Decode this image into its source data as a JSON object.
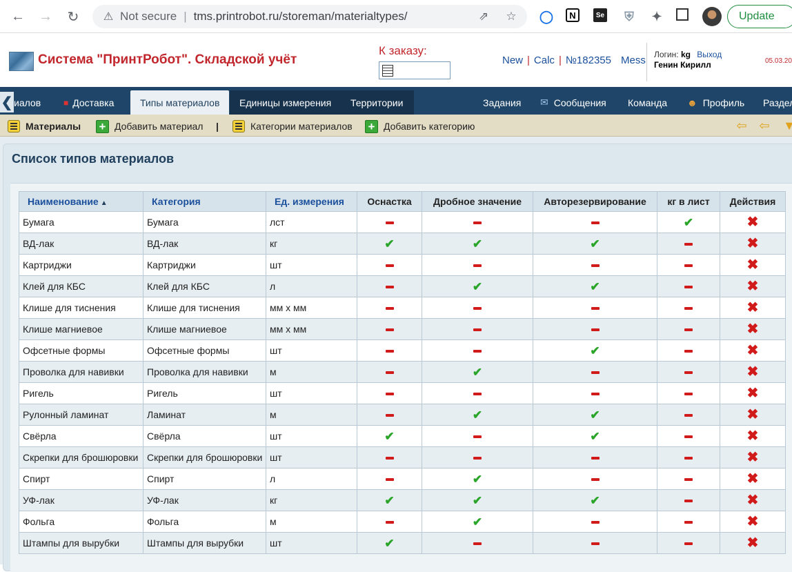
{
  "browser": {
    "security": "Not secure",
    "url": "tms.printrobot.ru/storeman/materialtypes/",
    "update_label": "Update"
  },
  "header": {
    "app_title": "Система \"ПринтРобот\". Складской учёт",
    "order_label": "К заказу:",
    "links": [
      "New",
      "Calc",
      "№182355",
      "Mess"
    ],
    "login_label": "Логин:",
    "login_value": "kg",
    "logout": "Выход",
    "user_name": "Генин Кирилл",
    "date": "05.03.20"
  },
  "tabs": {
    "left": [
      {
        "label": "иалов"
      },
      {
        "label": "Доставка"
      },
      {
        "label": "Типы материалов",
        "active": true
      },
      {
        "label": "Единицы измерения"
      },
      {
        "label": "Территории"
      }
    ],
    "right": [
      {
        "label": "Задания"
      },
      {
        "label": "Сообщения"
      },
      {
        "label": "Команда"
      },
      {
        "label": "Профиль"
      },
      {
        "label": "Раздел"
      }
    ]
  },
  "toolbar": {
    "materials": "Материалы",
    "add_material": "Добавить материал",
    "separator": "|",
    "categories": "Категории материалов",
    "add_category": "Добавить категорию"
  },
  "page": {
    "title": "Список типов материалов"
  },
  "table": {
    "columns": [
      "Наименование",
      "Категория",
      "Ед. измерения",
      "Оснастка",
      "Дробное значение",
      "Авторезервирование",
      "кг в лист",
      "Действия"
    ],
    "rows": [
      {
        "name": "Бумага",
        "category": "Бумага",
        "unit": "лст",
        "flags": [
          0,
          0,
          0,
          1
        ]
      },
      {
        "name": "ВД-лак",
        "category": "ВД-лак",
        "unit": "кг",
        "flags": [
          1,
          1,
          1,
          0
        ]
      },
      {
        "name": "Картриджи",
        "category": "Картриджи",
        "unit": "шт",
        "flags": [
          0,
          0,
          0,
          0
        ]
      },
      {
        "name": "Клей для КБС",
        "category": "Клей для КБС",
        "unit": "л",
        "flags": [
          0,
          1,
          1,
          0
        ]
      },
      {
        "name": "Клише для тиснения",
        "category": "Клише для тиснения",
        "unit": "мм x мм",
        "flags": [
          0,
          0,
          0,
          0
        ]
      },
      {
        "name": "Клише магниевое",
        "category": "Клише магниевое",
        "unit": "мм x мм",
        "flags": [
          0,
          0,
          0,
          0
        ]
      },
      {
        "name": "Офсетные формы",
        "category": "Офсетные формы",
        "unit": "шт",
        "flags": [
          0,
          0,
          1,
          0
        ]
      },
      {
        "name": "Проволка для навивки",
        "category": "Проволка для навивки",
        "unit": "м",
        "flags": [
          0,
          1,
          0,
          0
        ]
      },
      {
        "name": "Ригель",
        "category": "Ригель",
        "unit": "шт",
        "flags": [
          0,
          0,
          0,
          0
        ]
      },
      {
        "name": "Рулонный ламинат",
        "category": "Ламинат",
        "unit": "м",
        "flags": [
          0,
          1,
          1,
          0
        ]
      },
      {
        "name": "Свёрла",
        "category": "Свёрла",
        "unit": "шт",
        "flags": [
          1,
          0,
          1,
          0
        ]
      },
      {
        "name": "Скрепки для брошюровки",
        "category": "Скрепки для брошюровки",
        "unit": "шт",
        "flags": [
          0,
          0,
          0,
          0
        ]
      },
      {
        "name": "Спирт",
        "category": "Спирт",
        "unit": "л",
        "flags": [
          0,
          1,
          0,
          0
        ]
      },
      {
        "name": "УФ-лак",
        "category": "УФ-лак",
        "unit": "кг",
        "flags": [
          1,
          1,
          1,
          0
        ]
      },
      {
        "name": "Фольга",
        "category": "Фольга",
        "unit": "м",
        "flags": [
          0,
          1,
          0,
          0
        ]
      },
      {
        "name": "Штампы для вырубки",
        "category": "Штампы для вырубки",
        "unit": "шт",
        "flags": [
          1,
          0,
          0,
          0
        ]
      }
    ]
  }
}
